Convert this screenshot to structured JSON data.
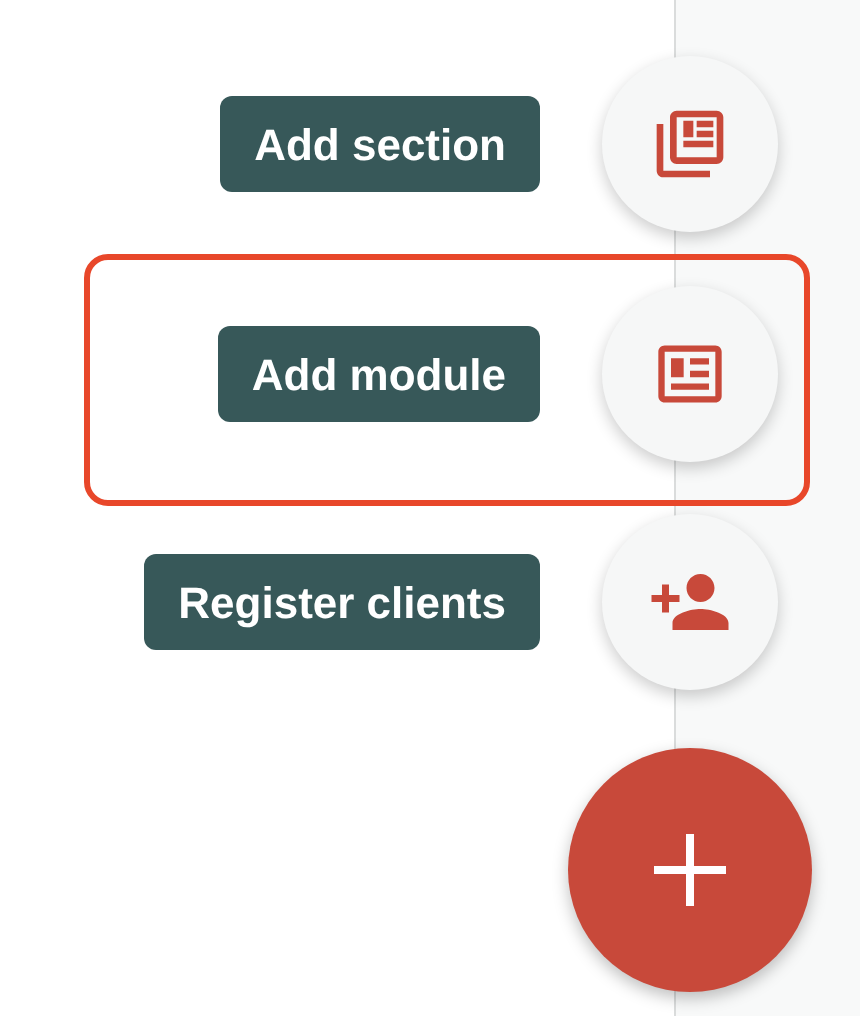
{
  "actions": [
    {
      "label": "Add section",
      "kind": "sections",
      "selected": false
    },
    {
      "label": "Add module",
      "kind": "module",
      "selected": true
    },
    {
      "label": "Register clients",
      "kind": "add-person",
      "selected": false
    }
  ],
  "fab": {
    "kind": "plus"
  }
}
